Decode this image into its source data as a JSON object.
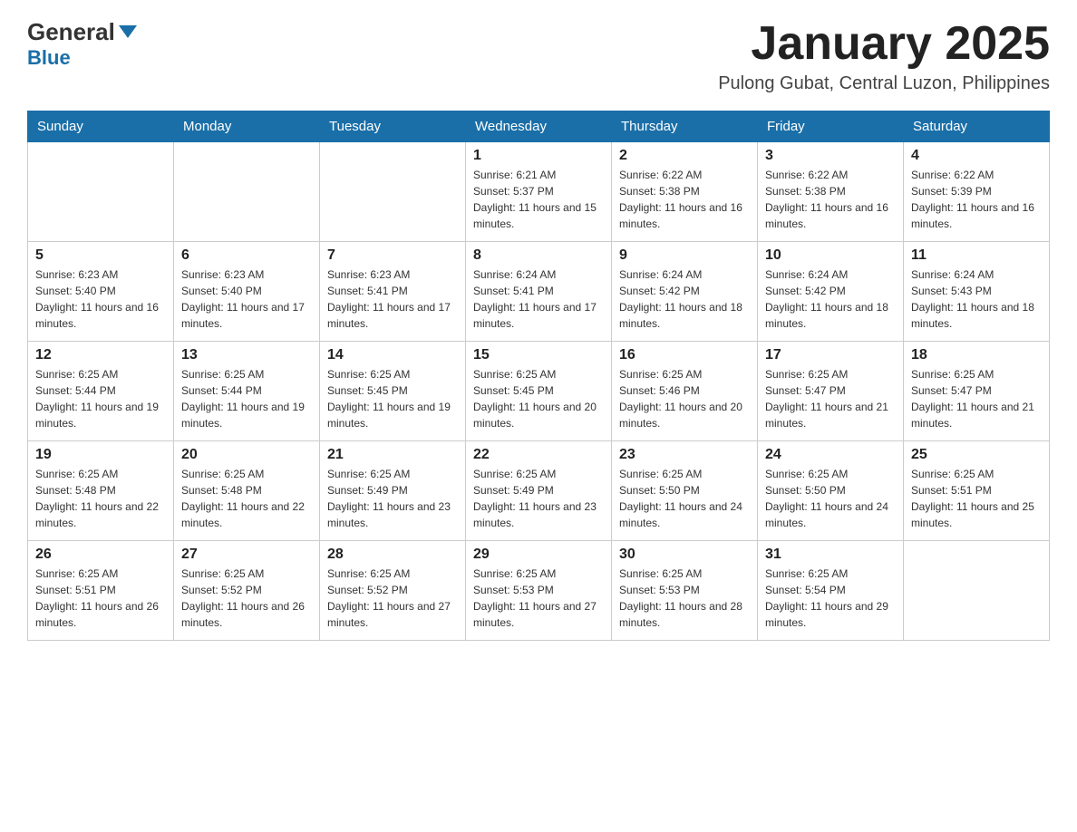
{
  "header": {
    "logo_general": "General",
    "logo_blue": "Blue",
    "month_title": "January 2025",
    "location": "Pulong Gubat, Central Luzon, Philippines"
  },
  "days_of_week": [
    "Sunday",
    "Monday",
    "Tuesday",
    "Wednesday",
    "Thursday",
    "Friday",
    "Saturday"
  ],
  "weeks": [
    [
      {
        "day": "",
        "info": ""
      },
      {
        "day": "",
        "info": ""
      },
      {
        "day": "",
        "info": ""
      },
      {
        "day": "1",
        "info": "Sunrise: 6:21 AM\nSunset: 5:37 PM\nDaylight: 11 hours and 15 minutes."
      },
      {
        "day": "2",
        "info": "Sunrise: 6:22 AM\nSunset: 5:38 PM\nDaylight: 11 hours and 16 minutes."
      },
      {
        "day": "3",
        "info": "Sunrise: 6:22 AM\nSunset: 5:38 PM\nDaylight: 11 hours and 16 minutes."
      },
      {
        "day": "4",
        "info": "Sunrise: 6:22 AM\nSunset: 5:39 PM\nDaylight: 11 hours and 16 minutes."
      }
    ],
    [
      {
        "day": "5",
        "info": "Sunrise: 6:23 AM\nSunset: 5:40 PM\nDaylight: 11 hours and 16 minutes."
      },
      {
        "day": "6",
        "info": "Sunrise: 6:23 AM\nSunset: 5:40 PM\nDaylight: 11 hours and 17 minutes."
      },
      {
        "day": "7",
        "info": "Sunrise: 6:23 AM\nSunset: 5:41 PM\nDaylight: 11 hours and 17 minutes."
      },
      {
        "day": "8",
        "info": "Sunrise: 6:24 AM\nSunset: 5:41 PM\nDaylight: 11 hours and 17 minutes."
      },
      {
        "day": "9",
        "info": "Sunrise: 6:24 AM\nSunset: 5:42 PM\nDaylight: 11 hours and 18 minutes."
      },
      {
        "day": "10",
        "info": "Sunrise: 6:24 AM\nSunset: 5:42 PM\nDaylight: 11 hours and 18 minutes."
      },
      {
        "day": "11",
        "info": "Sunrise: 6:24 AM\nSunset: 5:43 PM\nDaylight: 11 hours and 18 minutes."
      }
    ],
    [
      {
        "day": "12",
        "info": "Sunrise: 6:25 AM\nSunset: 5:44 PM\nDaylight: 11 hours and 19 minutes."
      },
      {
        "day": "13",
        "info": "Sunrise: 6:25 AM\nSunset: 5:44 PM\nDaylight: 11 hours and 19 minutes."
      },
      {
        "day": "14",
        "info": "Sunrise: 6:25 AM\nSunset: 5:45 PM\nDaylight: 11 hours and 19 minutes."
      },
      {
        "day": "15",
        "info": "Sunrise: 6:25 AM\nSunset: 5:45 PM\nDaylight: 11 hours and 20 minutes."
      },
      {
        "day": "16",
        "info": "Sunrise: 6:25 AM\nSunset: 5:46 PM\nDaylight: 11 hours and 20 minutes."
      },
      {
        "day": "17",
        "info": "Sunrise: 6:25 AM\nSunset: 5:47 PM\nDaylight: 11 hours and 21 minutes."
      },
      {
        "day": "18",
        "info": "Sunrise: 6:25 AM\nSunset: 5:47 PM\nDaylight: 11 hours and 21 minutes."
      }
    ],
    [
      {
        "day": "19",
        "info": "Sunrise: 6:25 AM\nSunset: 5:48 PM\nDaylight: 11 hours and 22 minutes."
      },
      {
        "day": "20",
        "info": "Sunrise: 6:25 AM\nSunset: 5:48 PM\nDaylight: 11 hours and 22 minutes."
      },
      {
        "day": "21",
        "info": "Sunrise: 6:25 AM\nSunset: 5:49 PM\nDaylight: 11 hours and 23 minutes."
      },
      {
        "day": "22",
        "info": "Sunrise: 6:25 AM\nSunset: 5:49 PM\nDaylight: 11 hours and 23 minutes."
      },
      {
        "day": "23",
        "info": "Sunrise: 6:25 AM\nSunset: 5:50 PM\nDaylight: 11 hours and 24 minutes."
      },
      {
        "day": "24",
        "info": "Sunrise: 6:25 AM\nSunset: 5:50 PM\nDaylight: 11 hours and 24 minutes."
      },
      {
        "day": "25",
        "info": "Sunrise: 6:25 AM\nSunset: 5:51 PM\nDaylight: 11 hours and 25 minutes."
      }
    ],
    [
      {
        "day": "26",
        "info": "Sunrise: 6:25 AM\nSunset: 5:51 PM\nDaylight: 11 hours and 26 minutes."
      },
      {
        "day": "27",
        "info": "Sunrise: 6:25 AM\nSunset: 5:52 PM\nDaylight: 11 hours and 26 minutes."
      },
      {
        "day": "28",
        "info": "Sunrise: 6:25 AM\nSunset: 5:52 PM\nDaylight: 11 hours and 27 minutes."
      },
      {
        "day": "29",
        "info": "Sunrise: 6:25 AM\nSunset: 5:53 PM\nDaylight: 11 hours and 27 minutes."
      },
      {
        "day": "30",
        "info": "Sunrise: 6:25 AM\nSunset: 5:53 PM\nDaylight: 11 hours and 28 minutes."
      },
      {
        "day": "31",
        "info": "Sunrise: 6:25 AM\nSunset: 5:54 PM\nDaylight: 11 hours and 29 minutes."
      },
      {
        "day": "",
        "info": ""
      }
    ]
  ]
}
